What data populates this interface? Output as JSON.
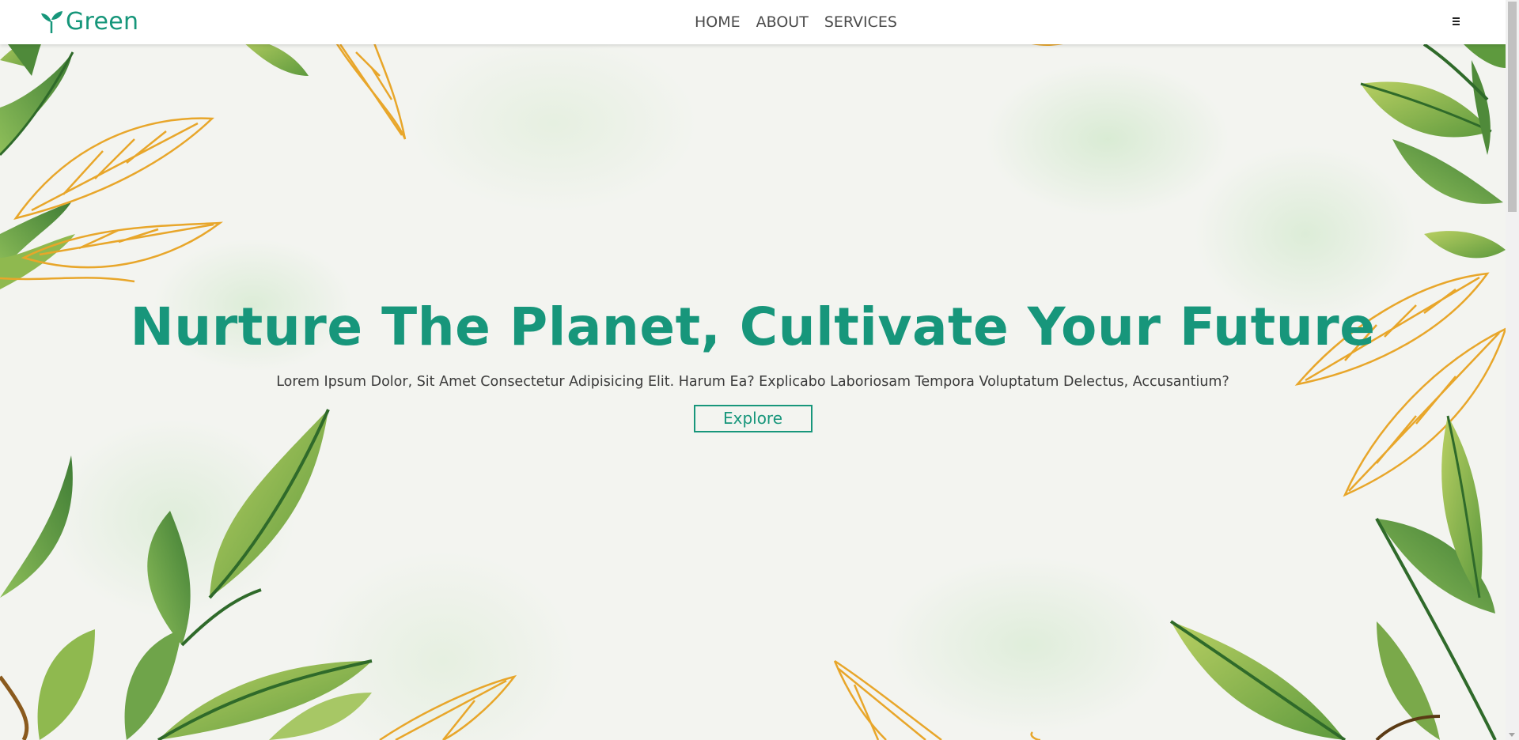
{
  "header": {
    "logo_text": "Green",
    "logo_icon": "sprout-icon",
    "nav": [
      {
        "label": "HOME"
      },
      {
        "label": "ABOUT"
      },
      {
        "label": "SERVICES"
      }
    ],
    "menu_icon": "hamburger-menu-icon"
  },
  "hero": {
    "title": "Nurture The Planet, Cultivate Your Future",
    "subtitle": "Lorem Ipsum Dolor, Sit Amet Consectetur Adipisicing Elit. Harum Ea? Explicabo Laboriosam Tempora Voluptatum Delectus, Accusantium?",
    "button_label": "Explore",
    "background": "watercolor-leaves-illustration"
  },
  "colors": {
    "accent": "#17967b",
    "text": "#3a3a3a",
    "nav_text": "#4b4b4b",
    "leaf_green": "#7fae4c",
    "leaf_dark": "#2f6a2a",
    "leaf_gold": "#e8a62a"
  }
}
